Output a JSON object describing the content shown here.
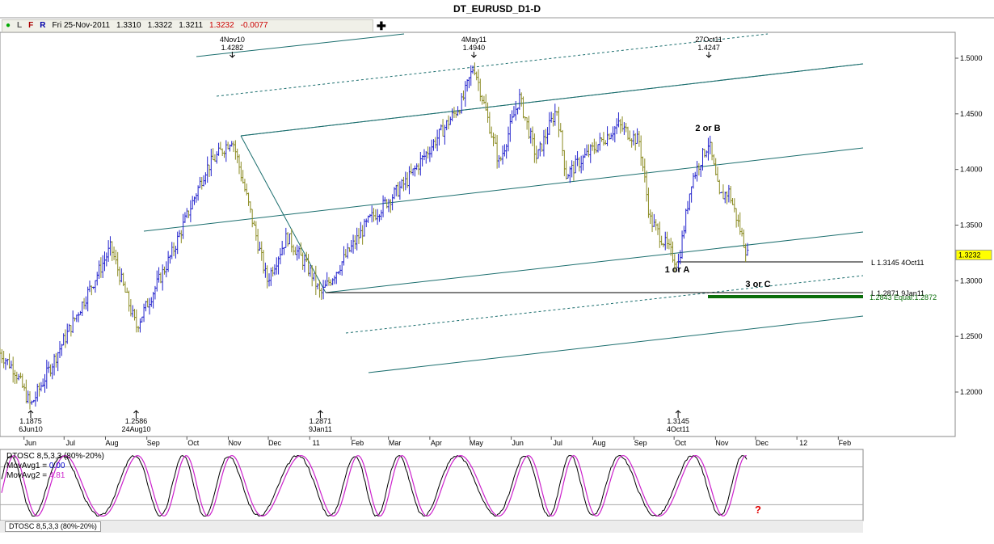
{
  "window": {
    "title": "DT_EURUSD_D1-D"
  },
  "info_bar": {
    "toggle_l": "L",
    "toggle_f": "F",
    "toggle_r": "R",
    "date": "Fri 25-Nov-2011",
    "open": "1.3310",
    "high": "1.3322",
    "low": "1.3211",
    "close": "1.3232",
    "change": "-0.0077"
  },
  "colors": {
    "up_bar": "#2222cc",
    "down_bar": "#8b8b22",
    "channel": "#1b6e6e",
    "osc1": "#000000",
    "osc2": "#cc22cc",
    "support": "#0a6e0a",
    "last_price_bg": "#ffff00"
  },
  "chart_data": [
    {
      "type": "ohlc",
      "title": "DT_EURUSD_D1-D",
      "ylim": [
        1.17,
        1.53
      ],
      "ytick_labels": [
        "1.5000",
        "1.4500",
        "1.4000",
        "1.3500",
        "1.3000",
        "1.2500",
        "1.2000"
      ],
      "xtick_labels": [
        "Jun",
        "Jul",
        "Aug",
        "Sep",
        "Oct",
        "Nov",
        "Dec",
        "11",
        "Feb",
        "Mar",
        "Apr",
        "May",
        "Jun",
        "Jul",
        "Aug",
        "Sep",
        "Oct",
        "Nov",
        "Dec",
        "12",
        "Feb"
      ],
      "last_price": "1.3232",
      "key_points": [
        {
          "date": "6Jun10",
          "value": 1.1875
        },
        {
          "date": "24Aug10",
          "value": 1.2586
        },
        {
          "date": "4Nov10",
          "value": 1.4282
        },
        {
          "date": "9Jan11",
          "value": 1.2871
        },
        {
          "date": "4May11",
          "value": 1.494
        },
        {
          "date": "4Oct11",
          "value": 1.3145
        },
        {
          "date": "27Oct11",
          "value": 1.4247
        },
        {
          "date": "25Nov11",
          "value": 1.3232
        }
      ],
      "swing_labels": [
        {
          "date": "4Nov10",
          "value": "1.4282",
          "position": "top"
        },
        {
          "date": "4May11",
          "value": "1.4940",
          "position": "top"
        },
        {
          "date": "27Oct11",
          "value": "1.4247",
          "position": "top"
        },
        {
          "date": "6Jun10",
          "value": "1.1875",
          "position": "bottom"
        },
        {
          "date": "24Aug10",
          "value": "1.2586",
          "position": "bottom"
        },
        {
          "date": "9Jan11",
          "value": "1.2871",
          "position": "bottom"
        },
        {
          "date": "4Oct11",
          "value": "1.3145",
          "position": "bottom"
        }
      ],
      "wave_labels": [
        "2 or B",
        "1 or A",
        "3 or C"
      ],
      "level_labels": {
        "low_oct": "L 1.3145 4Oct11",
        "low_jan": "L 1.2871 9Jan11",
        "projection": "1.2843 Equal:1.2872"
      }
    },
    {
      "type": "line",
      "title": "DTOSC 8,5,3,3 (80%-20%)",
      "ylim": [
        0,
        100
      ],
      "levels": [
        80,
        20
      ],
      "series": [
        {
          "name": "MovAvg1",
          "value": "0.00"
        },
        {
          "name": "MovAvg2",
          "value": "4.81"
        }
      ]
    }
  ],
  "oscillator_tab": "DTOSC 8,5,3,3 (80%-20%)",
  "alert_symbol": "?"
}
